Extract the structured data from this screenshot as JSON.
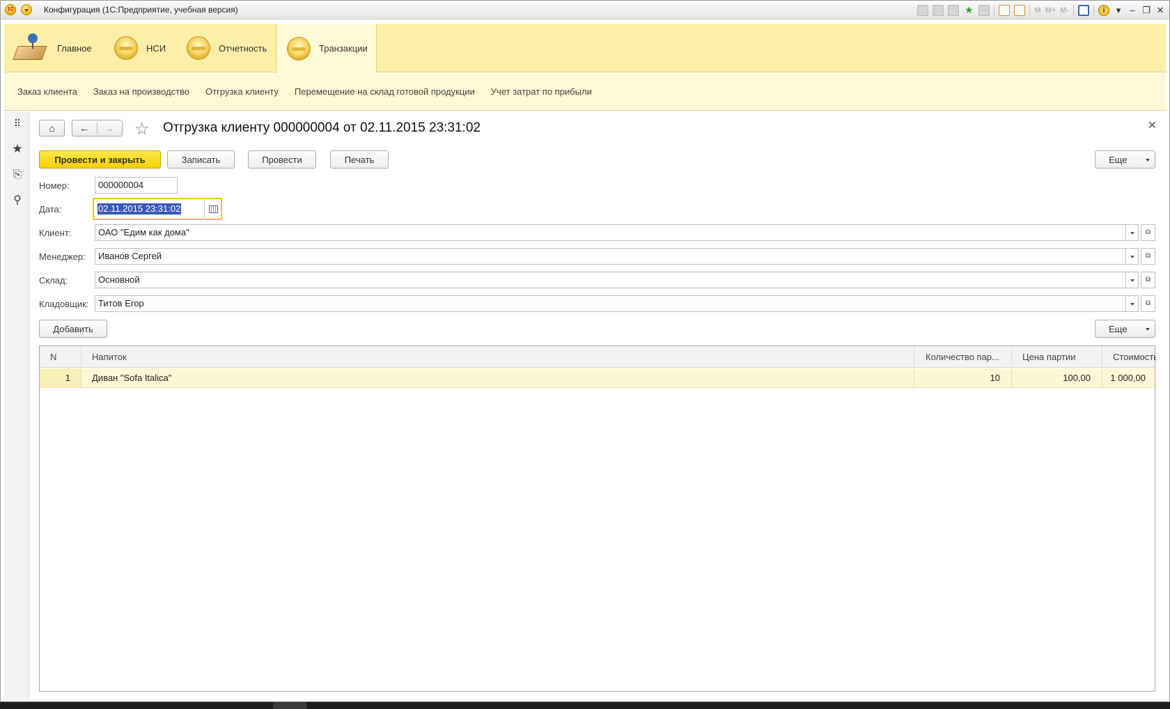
{
  "window": {
    "title": "Конфигурация  (1С:Предприятие, учебная версия)",
    "toolbar_text": [
      "M",
      "M+",
      "M-"
    ],
    "info_glyph": "i"
  },
  "sections": [
    {
      "label": "Главное",
      "icon": "desk-lamp-icon"
    },
    {
      "label": "НСИ",
      "icon": "section-icon"
    },
    {
      "label": "Отчетность",
      "icon": "section-icon"
    },
    {
      "label": "Транзакции",
      "icon": "section-icon",
      "active": true
    }
  ],
  "commands": [
    "Заказ клиента",
    "Заказ на производство",
    "Отгрузка клиенту",
    "Перемещение на склад готовой продукции",
    "Учет затрат по прибыли"
  ],
  "form": {
    "title": "Отгрузка клиенту 000000004 от 02.11.2015 23:31:02",
    "buttons": {
      "post_close": "Провести и закрыть",
      "save": "Записать",
      "post": "Провести",
      "print": "Печать",
      "more": "Еще"
    },
    "fields": {
      "number_label": "Номер:",
      "number_value": "000000004",
      "date_label": "Дата:",
      "date_value": "02.11.2015 23:31:02",
      "client_label": "Клиент:",
      "client_value": "ОАО \"Едим как дома\"",
      "manager_label": "Менеджер:",
      "manager_value": "Иванов Сергей",
      "warehouse_label": "Склад:",
      "warehouse_value": "Основной",
      "storekeeper_label": "Кладовщик:",
      "storekeeper_value": "Титов Егор"
    },
    "table_buttons": {
      "add": "Добавить",
      "more": "Еще"
    },
    "table": {
      "columns": [
        "N",
        "Напиток",
        "Количество пар...",
        "Цена партии",
        "Стоимость"
      ],
      "rows": [
        {
          "n": "1",
          "item": "Диван \"Sofa Italica\"",
          "qty": "10",
          "price": "100,00",
          "cost": "1 000,00"
        }
      ]
    }
  },
  "colors": {
    "sections_bg": "#fbeea6",
    "commands_bg": "#fff8d4",
    "primary_button": "#f5cf00",
    "selection": "#3a59b8",
    "row_highlight": "#fdf7d5"
  }
}
